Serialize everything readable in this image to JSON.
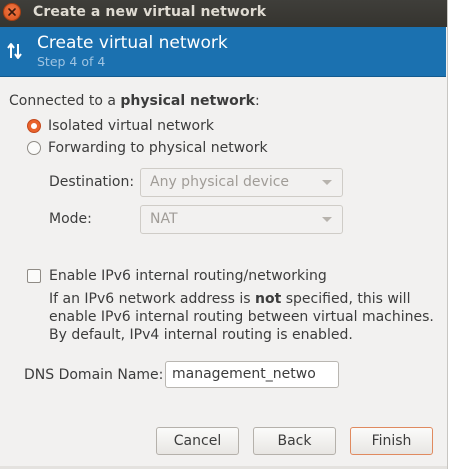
{
  "window": {
    "title": "Create a new virtual network"
  },
  "header": {
    "title": "Create virtual network",
    "step": "Step 4 of 4"
  },
  "network": {
    "section_prefix": "Connected to a ",
    "section_bold": "physical network",
    "section_suffix": ":",
    "options": [
      {
        "label": "Isolated virtual network",
        "selected": true
      },
      {
        "label": "Forwarding to physical network",
        "selected": false
      }
    ],
    "destination_label": "Destination:",
    "destination_value": "Any physical device",
    "mode_label": "Mode:",
    "mode_value": "NAT"
  },
  "ipv6": {
    "checkbox_label": "Enable IPv6 internal routing/networking",
    "checked": false,
    "info_line1_prefix": "If an IPv6 network address is ",
    "info_line1_bold": "not",
    "info_line1_suffix": " specified, this will",
    "info_line2": "enable IPv6 internal routing between virtual machines.",
    "info_line3": "By default, IPv4 internal routing is enabled."
  },
  "dns": {
    "label": "DNS Domain Name:",
    "value": "management_netwo"
  },
  "buttons": {
    "cancel": "Cancel",
    "back": "Back",
    "finish": "Finish"
  },
  "icons": {
    "close": "close-icon",
    "network": "network-transfer-icon",
    "dropdown": "chevron-down-icon"
  },
  "colors": {
    "header_bg": "#1b71b0",
    "accent": "#e9632c",
    "titlebar_bg": "#3f3e3a"
  }
}
